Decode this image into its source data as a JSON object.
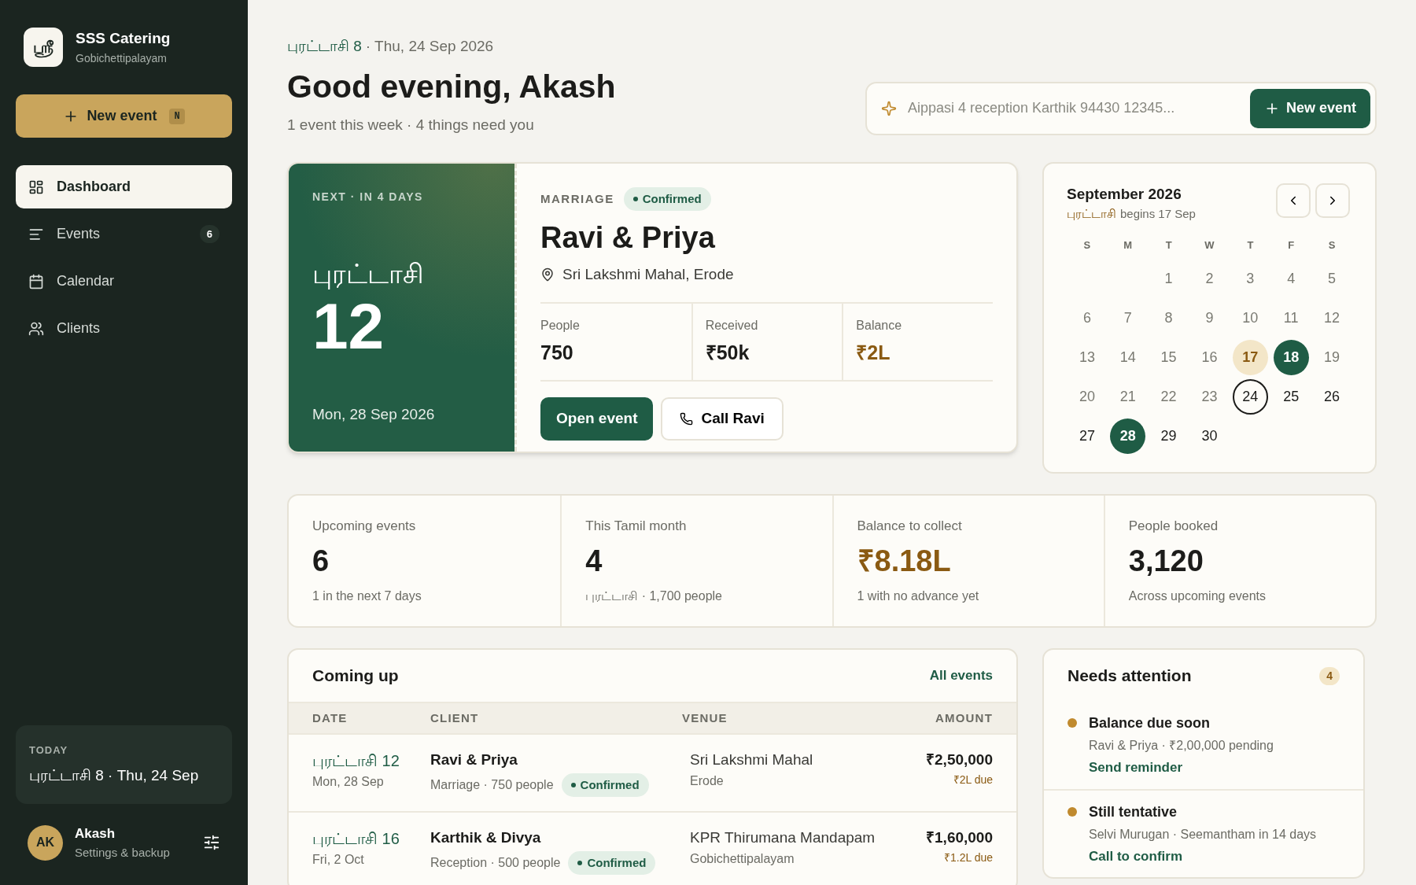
{
  "sidebar": {
    "brand": {
      "logo": "ஸ்ரீ",
      "name": "SSS Catering",
      "location": "Gobichettipalayam"
    },
    "new_event": {
      "label": "New event",
      "shortcut": "N"
    },
    "nav": [
      {
        "label": "Dashboard",
        "selected": true
      },
      {
        "label": "Events",
        "selected": false,
        "badge": "6"
      },
      {
        "label": "Calendar",
        "selected": false
      },
      {
        "label": "Clients",
        "selected": false
      }
    ],
    "today": {
      "label": "TODAY",
      "date": "புரட்டாசி 8 · Thu, 24 Sep"
    },
    "user": {
      "initials": "AK",
      "name": "Akash",
      "subtitle": "Settings & backup"
    }
  },
  "header": {
    "tamil_date": "புரட்டாசி 8",
    "date": "· Thu, 24 Sep 2026",
    "greeting": "Good evening, Akash",
    "summary": "1 event this week · 4 things need you"
  },
  "quick_add": {
    "placeholder": "Aippasi 4 reception Karthik 94430 12345...",
    "button": "New event"
  },
  "next_event": {
    "eyebrow": "NEXT · IN 4 DAYS",
    "tamil_month": "புரட்டாசி",
    "day": "12",
    "date": "Mon, 28 Sep 2026",
    "type": "MARRIAGE",
    "status": "Confirmed",
    "client": "Ravi & Priya",
    "venue": "Sri Lakshmi Mahal, Erode",
    "stats": [
      {
        "label": "People",
        "value": "750",
        "kind": "plain"
      },
      {
        "label": "Received",
        "value": "₹50k",
        "kind": "plain"
      },
      {
        "label": "Balance",
        "value": "₹2L",
        "kind": "due"
      }
    ],
    "primary_action": "Open event",
    "call_action": "Call Ravi"
  },
  "calendar": {
    "title": "September 2026",
    "tamil_month": "புரட்டாசி",
    "begins": "begins 17 Sep",
    "weekdays": [
      "S",
      "M",
      "T",
      "W",
      "T",
      "F",
      "S"
    ],
    "days": [
      {
        "kind": "blank"
      },
      {
        "kind": "blank"
      },
      {
        "day": "1",
        "kind": "past"
      },
      {
        "day": "2",
        "kind": "past"
      },
      {
        "day": "3",
        "kind": "past"
      },
      {
        "day": "4",
        "kind": "past"
      },
      {
        "day": "5",
        "kind": "past"
      },
      {
        "day": "6",
        "kind": "past"
      },
      {
        "day": "7",
        "kind": "past"
      },
      {
        "day": "8",
        "kind": "past"
      },
      {
        "day": "9",
        "kind": "past"
      },
      {
        "day": "10",
        "kind": "past"
      },
      {
        "day": "11",
        "kind": "past"
      },
      {
        "day": "12",
        "kind": "past"
      },
      {
        "day": "13",
        "kind": "past"
      },
      {
        "day": "14",
        "kind": "past"
      },
      {
        "day": "15",
        "kind": "past"
      },
      {
        "day": "16",
        "kind": "past"
      },
      {
        "day": "17",
        "kind": "month_start"
      },
      {
        "day": "18",
        "kind": "event"
      },
      {
        "day": "19",
        "kind": "past"
      },
      {
        "day": "20",
        "kind": "past"
      },
      {
        "day": "21",
        "kind": "past"
      },
      {
        "day": "22",
        "kind": "past"
      },
      {
        "day": "23",
        "kind": "past"
      },
      {
        "day": "24",
        "kind": "today"
      },
      {
        "day": "25",
        "kind": "upcoming"
      },
      {
        "day": "26",
        "kind": "upcoming"
      },
      {
        "day": "27",
        "kind": "upcoming"
      },
      {
        "day": "28",
        "kind": "event"
      },
      {
        "day": "29",
        "kind": "upcoming"
      },
      {
        "day": "30",
        "kind": "upcoming"
      }
    ]
  },
  "stats": [
    {
      "label": "Upcoming events",
      "value": "6",
      "note": "1 in the next 7 days",
      "kind": "plain"
    },
    {
      "label": "This Tamil month",
      "value": "4",
      "note": "புரட்டாசி · 1,700 people",
      "kind": "plain"
    },
    {
      "label": "Balance to collect",
      "value": "₹8.18L",
      "note": "1 with no advance yet",
      "kind": "due"
    },
    {
      "label": "People booked",
      "value": "3,120",
      "note": "Across upcoming events",
      "kind": "plain"
    }
  ],
  "coming_up": {
    "title": "Coming up",
    "link": "All events",
    "columns": [
      "DATE",
      "CLIENT",
      "VENUE",
      "AMOUNT"
    ],
    "rows": [
      {
        "tamil_date": "புரட்டாசி 12",
        "date": "Mon, 28 Sep",
        "client": "Ravi & Priya",
        "details": "Marriage · 750 people",
        "status": "Confirmed",
        "venue": "Sri Lakshmi Mahal",
        "city": "Erode",
        "amount": "₹2,50,000",
        "due": "₹2L due"
      },
      {
        "tamil_date": "புரட்டாசி 16",
        "date": "Fri, 2 Oct",
        "client": "Karthik & Divya",
        "details": "Reception · 500 people",
        "status": "Confirmed",
        "venue": "KPR Thirumana Mandapam",
        "city": "Gobichettipalayam",
        "amount": "₹1,60,000",
        "due": "₹1.2L due"
      }
    ]
  },
  "attention": {
    "title": "Needs attention",
    "count": "4",
    "items": [
      {
        "color": "#c08a2e",
        "title": "Balance due soon",
        "detail": "Ravi & Priya · ₹2,00,000 pending",
        "action": "Send reminder"
      },
      {
        "color": "#c08a2e",
        "title": "Still tentative",
        "detail": "Selvi Murugan · Seemantham in 14 days",
        "action": "Call to confirm"
      }
    ]
  }
}
